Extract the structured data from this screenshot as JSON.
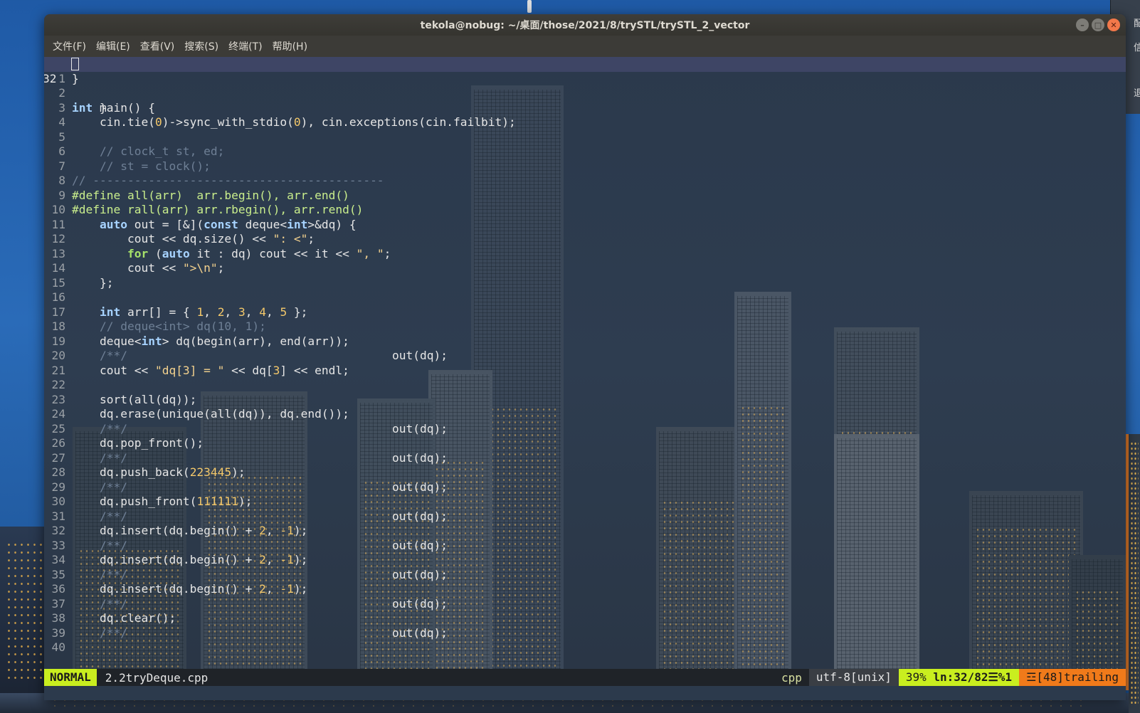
{
  "window": {
    "title": "tekola@nobug: ~/桌面/those/2021/8/trySTL/trySTL_2_vector",
    "controls": {
      "minimize": "–",
      "maximize": "□",
      "close": "✕"
    }
  },
  "menu": [
    "文件(F)",
    "编辑(E)",
    "查看(V)",
    "搜索(S)",
    "终端(T)",
    "帮助(H)"
  ],
  "desktop_panel": [
    "配",
    "信",
    "退"
  ],
  "editor": {
    "current_line_number": "32",
    "current_line_text": "    }",
    "lines": [
      {
        "n": "1",
        "html": "}"
      },
      {
        "n": "2",
        "html": ""
      },
      {
        "n": "3",
        "html": "<span class=\"ty\">int</span> main() {"
      },
      {
        "n": "4",
        "html": "    cin.tie(<span class=\"num\">0</span>)->sync_with_stdio(<span class=\"num\">0</span>), cin.exceptions(cin.failbit);"
      },
      {
        "n": "5",
        "html": ""
      },
      {
        "n": "6",
        "html": "    <span class=\"cm\">// clock_t st, ed;</span>"
      },
      {
        "n": "7",
        "html": "    <span class=\"cm\">// st = clock();</span>"
      },
      {
        "n": "8",
        "html": "<span class=\"cm\">// ------------------------------------------</span>"
      },
      {
        "n": "9",
        "html": "<span class=\"pp\">#define all(arr)  arr.begin(), arr.end()</span>"
      },
      {
        "n": "10",
        "html": "<span class=\"pp\">#define rall(arr) arr.rbegin(), arr.rend()</span>"
      },
      {
        "n": "11",
        "html": "    <span class=\"kw\">auto</span> out = [&amp;](<span class=\"kw\">const</span> deque&lt;<span class=\"ty\">int</span>&gt;&amp;dq) {"
      },
      {
        "n": "12",
        "html": "        cout &lt;&lt; dq.size() &lt;&lt; <span class=\"str\">\": &lt;\"</span>;"
      },
      {
        "n": "13",
        "html": "        <span class=\"kw2\">for</span> (<span class=\"kw\">auto</span> it : dq) cout &lt;&lt; it &lt;&lt; <span class=\"str\">\", \"</span>;"
      },
      {
        "n": "14",
        "html": "        cout &lt;&lt; <span class=\"str\">\"&gt;\\n\"</span>;"
      },
      {
        "n": "15",
        "html": "    };"
      },
      {
        "n": "16",
        "html": ""
      },
      {
        "n": "17",
        "html": "    <span class=\"ty\">int</span> arr[] = { <span class=\"num\">1</span>, <span class=\"num\">2</span>, <span class=\"num\">3</span>, <span class=\"num\">4</span>, <span class=\"num\">5</span> };"
      },
      {
        "n": "18",
        "html": "    <span class=\"cm\">// deque&lt;int&gt; dq(10, 1);</span>"
      },
      {
        "n": "19",
        "html": "    deque&lt;<span class=\"ty\">int</span>&gt; dq(begin(arr), end(arr));"
      },
      {
        "n": "20",
        "html": "    <span class=\"cm\">/**/</span>",
        "tail": "out(dq);"
      },
      {
        "n": "21",
        "html": "    cout &lt;&lt; <span class=\"str\">\"dq[3] = \"</span> &lt;&lt; dq[<span class=\"num\">3</span>] &lt;&lt; endl;"
      },
      {
        "n": "22",
        "html": ""
      },
      {
        "n": "23",
        "html": "    sort(all(dq));"
      },
      {
        "n": "24",
        "html": "    dq.erase(unique(all(dq)), dq.end());"
      },
      {
        "n": "25",
        "html": "    <span class=\"cm\">/**/</span>",
        "tail": "out(dq);"
      },
      {
        "n": "26",
        "html": "    dq.pop_front();"
      },
      {
        "n": "27",
        "html": "    <span class=\"cm\">/**/</span>",
        "tail": "out(dq);"
      },
      {
        "n": "28",
        "html": "    dq.push_back(<span class=\"num\">223445</span>);"
      },
      {
        "n": "29",
        "html": "    <span class=\"cm\">/**/</span>",
        "tail": "out(dq);"
      },
      {
        "n": "30",
        "html": "    dq.push_front(<span class=\"num\">111111</span>);"
      },
      {
        "n": "31",
        "html": "    <span class=\"cm\">/**/</span>",
        "tail": "out(dq);"
      },
      {
        "n": "32",
        "html": "    dq.insert(dq.begin() + <span class=\"num\">2</span>, <span class=\"num\">-1</span>);"
      },
      {
        "n": "33",
        "html": "    <span class=\"cm\">/**/</span>",
        "tail": "out(dq);"
      },
      {
        "n": "34",
        "html": "    dq.insert(dq.begin() + <span class=\"num\">2</span>, <span class=\"num\">-1</span>);"
      },
      {
        "n": "35",
        "html": "    <span class=\"cm\">/**/</span>",
        "tail": "out(dq);"
      },
      {
        "n": "36",
        "html": "    dq.insert(dq.begin() + <span class=\"num\">2</span>, <span class=\"num\">-1</span>);"
      },
      {
        "n": "37",
        "html": "    <span class=\"cm\">/**/</span>",
        "tail": "out(dq);"
      },
      {
        "n": "38",
        "html": "    dq.clear();"
      },
      {
        "n": "39",
        "html": "    <span class=\"cm\">/**/</span>",
        "tail": "out(dq);"
      },
      {
        "n": "40",
        "html": ""
      }
    ]
  },
  "status": {
    "mode": "NORMAL",
    "filename": "2.2tryDeque.cpp",
    "filetype": "cpp",
    "encoding": "utf-8[unix]",
    "percent": "39%",
    "position": "ln:32/82☰%1",
    "trailing": "☲[48]trailing"
  },
  "colors": {
    "mode_bg": "#c9ee1f",
    "trailing_bg": "#f07a1a",
    "keyword": "#a7d3ff",
    "number": "#f4c86a",
    "comment": "#6e7f95",
    "preprocessor": "#c9ee8c"
  }
}
